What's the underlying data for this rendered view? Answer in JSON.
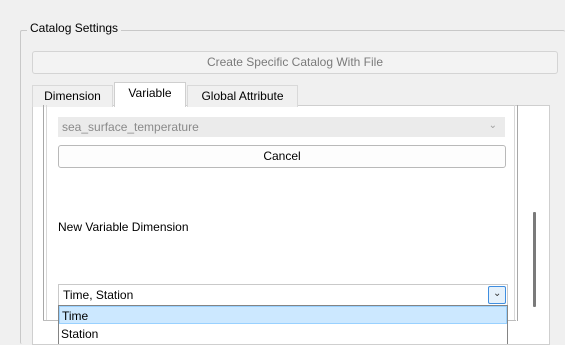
{
  "group": {
    "title": "Catalog Settings"
  },
  "create_button": {
    "label": "Create Specific Catalog With File"
  },
  "tabs": [
    {
      "label": "Dimension",
      "active": false
    },
    {
      "label": "Variable",
      "active": true
    },
    {
      "label": "Global Attribute",
      "active": false
    }
  ],
  "variable_combo": {
    "value": "sea_surface_temperature",
    "icon": "chevron-down-icon"
  },
  "cancel_button": {
    "label": "Cancel"
  },
  "new_dimension": {
    "label": "New Variable Dimension",
    "value": "Time, Station",
    "options": [
      {
        "label": "Time",
        "selected": true
      },
      {
        "label": "Station",
        "selected": false
      }
    ]
  }
}
